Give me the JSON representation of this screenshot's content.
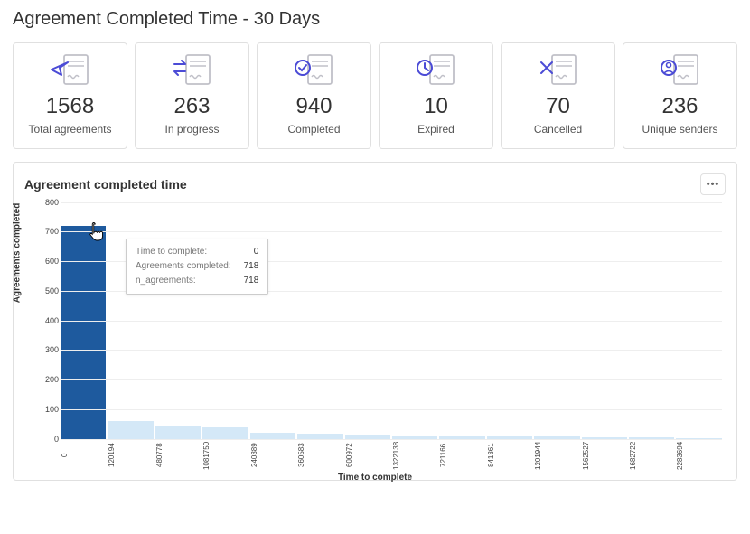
{
  "title": "Agreement Completed Time - 30 Days",
  "cards": [
    {
      "value": "1568",
      "label": "Total agreements",
      "icon": "send"
    },
    {
      "value": "263",
      "label": "In progress",
      "icon": "progress"
    },
    {
      "value": "940",
      "label": "Completed",
      "icon": "check"
    },
    {
      "value": "10",
      "label": "Expired",
      "icon": "clock"
    },
    {
      "value": "70",
      "label": "Cancelled",
      "icon": "cancel"
    },
    {
      "value": "236",
      "label": "Unique senders",
      "icon": "user"
    }
  ],
  "chart": {
    "title": "Agreement completed time",
    "more_label": "•••",
    "x_axis_label": "Time to complete",
    "y_axis_label": "Agreements completed",
    "y_ticks": [
      0,
      100,
      200,
      300,
      400,
      500,
      600,
      700,
      800
    ],
    "tooltip": {
      "rows": [
        {
          "label": "Time to complete:",
          "value": "0"
        },
        {
          "label": "Agreements completed:",
          "value": "718"
        },
        {
          "label": "n_agreements:",
          "value": "718"
        }
      ]
    }
  },
  "chart_data": {
    "type": "bar",
    "title": "Agreement completed time",
    "xlabel": "Time to complete",
    "ylabel": "Agreements completed",
    "ylim": [
      0,
      800
    ],
    "categories": [
      "0",
      "120194",
      "480778",
      "1081750",
      "240389",
      "360583",
      "600972",
      "1322138",
      "721166",
      "841361",
      "1201944",
      "1562527",
      "1682722",
      "2283694"
    ],
    "values": [
      718,
      60,
      42,
      40,
      20,
      16,
      14,
      12,
      10,
      10,
      8,
      4,
      4,
      2
    ],
    "highlighted_index": 0
  }
}
